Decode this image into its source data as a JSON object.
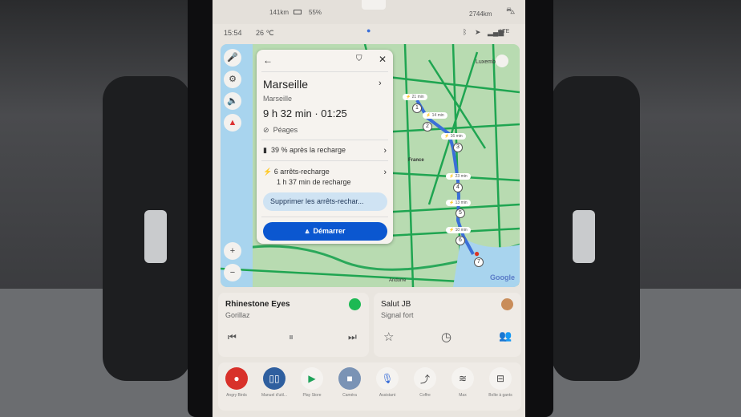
{
  "top_strip": {
    "range": "141km",
    "battery": "55%",
    "odometer": "2744km"
  },
  "status": {
    "time": "15:54",
    "temperature": "26 ℃",
    "network": "LTE"
  },
  "map": {
    "labels": {
      "luxembourg": "Luxemb",
      "france": "France",
      "andorre": "Andorre",
      "google": "Google"
    },
    "charge_stops": [
      {
        "n": "1",
        "time": "21 min"
      },
      {
        "n": "2",
        "time": "14 min"
      },
      {
        "n": "3",
        "time": "16 min"
      },
      {
        "n": "4",
        "time": "23 min"
      },
      {
        "n": "5",
        "time": "13 min"
      },
      {
        "n": "6",
        "time": "10 min"
      },
      {
        "n": "7",
        "time": ""
      }
    ],
    "zoom_in": "+",
    "zoom_out": "−",
    "route_color": "#3b6fd8"
  },
  "card": {
    "destination": "Marseille",
    "subtitle": "Marseille",
    "duration": "9 h 32 min · 01:25",
    "tolls": "Péages",
    "battery_after": "39 % après la recharge",
    "stops_title": "6 arrêts-recharge",
    "stops_time": "1 h 37 min de recharge",
    "remove_button": "Supprimer les arrêts-rechar...",
    "start_button": "Démarrer",
    "accent": "#0b57d0"
  },
  "media": {
    "track": "Rhinestone Eyes",
    "artist": "Gorillaz",
    "contact": "Salut JB",
    "signal": "Signal fort"
  },
  "dock": [
    {
      "label": "Angry Birds",
      "icon": "angry-birds-icon"
    },
    {
      "label": "Manuel d'util...",
      "icon": "book-icon"
    },
    {
      "label": "Play Store",
      "icon": "play-store-icon"
    },
    {
      "label": "Caméra",
      "icon": "camera-icon"
    },
    {
      "label": "Assistant",
      "icon": "microphone-icon"
    },
    {
      "label": "Coffre",
      "icon": "trunk-icon"
    },
    {
      "label": "Max",
      "icon": "defrost-icon"
    },
    {
      "label": "Boîte à gants",
      "icon": "glovebox-icon"
    }
  ]
}
